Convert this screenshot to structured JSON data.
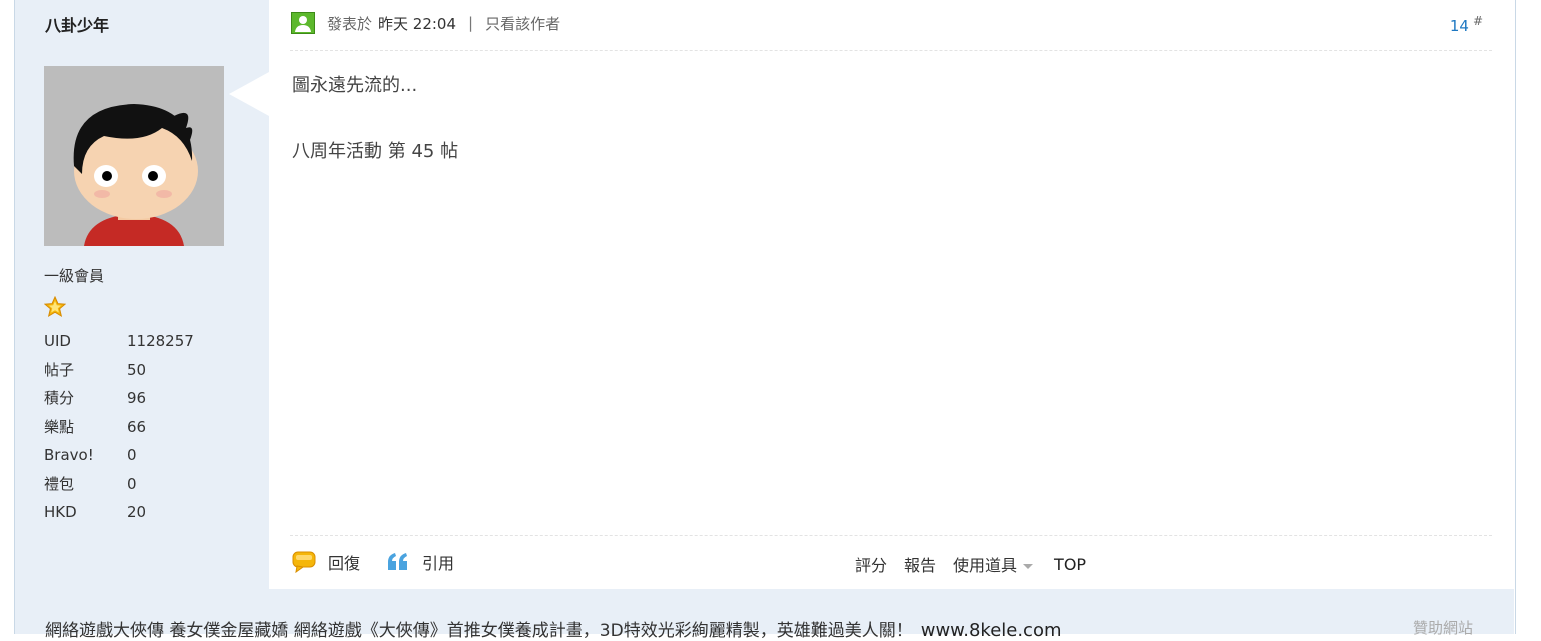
{
  "user": {
    "name": "八卦少年",
    "rank": "一級會員",
    "stats": [
      {
        "label": "UID",
        "value": "1128257"
      },
      {
        "label": "帖子",
        "value": "50"
      },
      {
        "label": "積分",
        "value": "96"
      },
      {
        "label": "樂點",
        "value": "66"
      },
      {
        "label": "Bravo!",
        "value": "0"
      },
      {
        "label": "禮包",
        "value": "0"
      },
      {
        "label": "HKD",
        "value": "20"
      }
    ]
  },
  "post": {
    "posted_label": "發表於",
    "posted_time": "昨天 22:04",
    "separator": "|",
    "author_only": "只看該作者",
    "floor": "14",
    "floor_mark": "#",
    "lines": [
      "圖永遠先流的...",
      "八周年活動 第 45 帖"
    ]
  },
  "actions": {
    "reply": "回復",
    "quote": "引用",
    "rate": "評分",
    "report": "報告",
    "tools": "使用道具",
    "top": "TOP"
  },
  "ad": {
    "text": "網絡遊戲大俠傳 養女僕金屋藏嬌 網絡遊戲《大俠傳》首推女僕養成計畫，3D特效光彩絢麗精製，英雄難過美人關！",
    "url": "www.8kele.com",
    "sponsor": "贊助網站"
  },
  "colors": {
    "sidebar_bg": "#e8eff7",
    "floor_link": "#1e78c2",
    "star": "#f5b60a",
    "reply_icon": "#f5b60a",
    "quote_icon": "#4aa3df"
  },
  "icons": [
    "online-user-icon",
    "star-icon",
    "reply-bubble-icon",
    "quote-icon",
    "dropdown-caret-icon"
  ]
}
